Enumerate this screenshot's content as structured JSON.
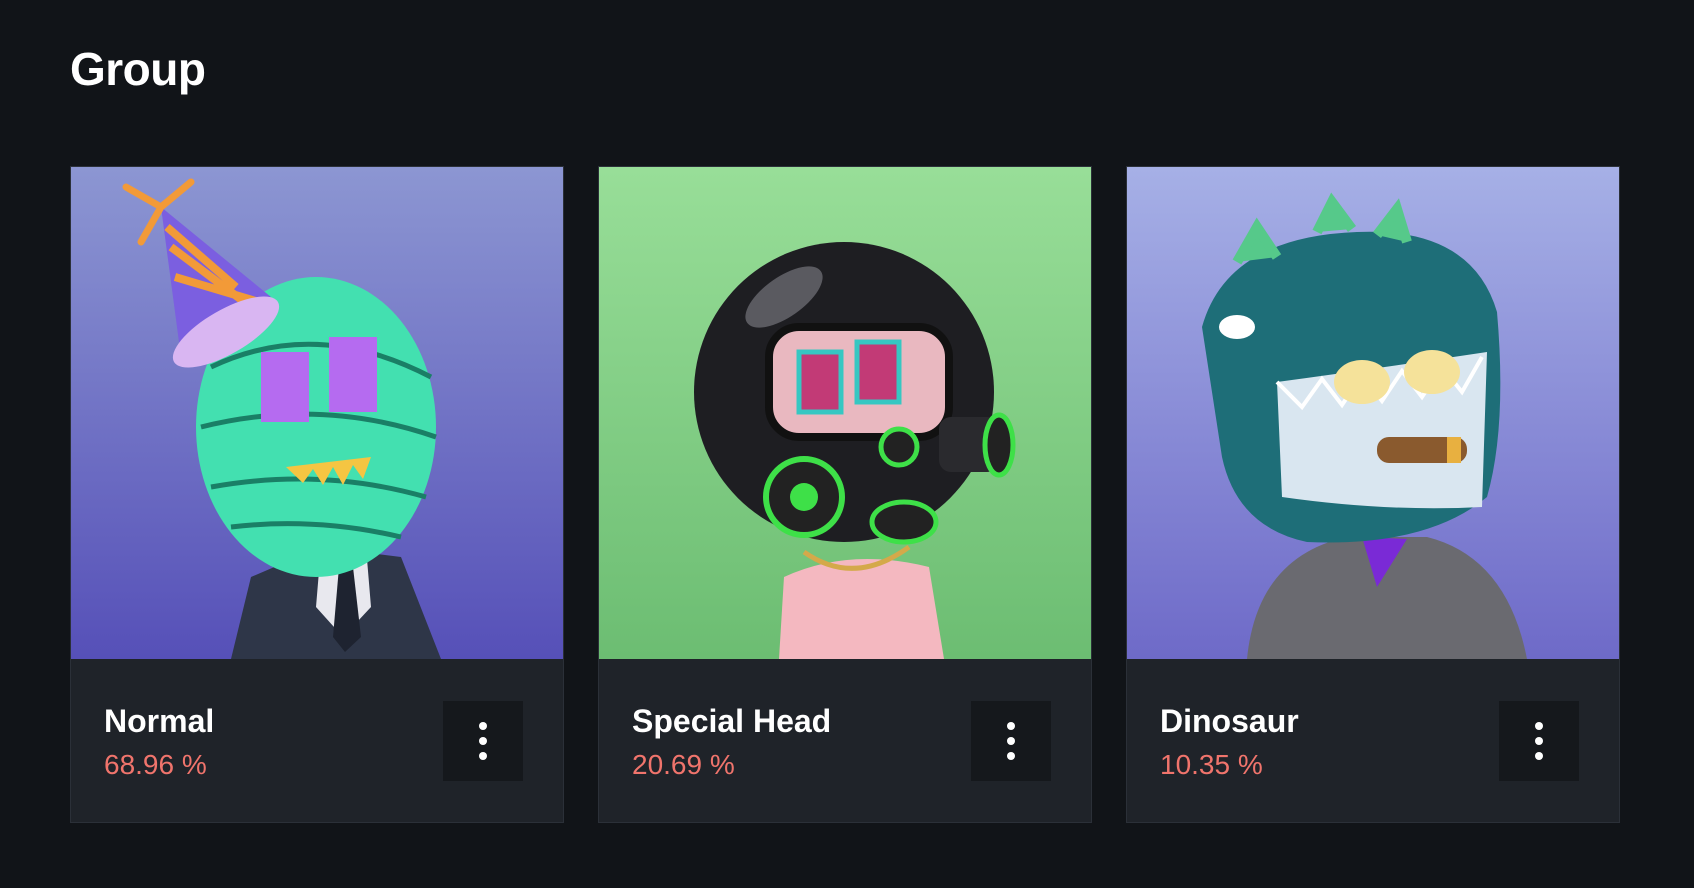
{
  "page": {
    "title": "Group"
  },
  "cards": [
    {
      "name": "Normal",
      "percent": "68.96 %",
      "image": "party-hat-scribble-character"
    },
    {
      "name": "Special Head",
      "percent": "20.69 %",
      "image": "gas-mask-helmet-character"
    },
    {
      "name": "Dinosaur",
      "percent": "10.35 %",
      "image": "dinosaur-hood-character"
    }
  ],
  "colors": {
    "background": "#111418",
    "card": "#1f2329",
    "percent": "#f0746c",
    "button": "#15181c"
  },
  "icons": {
    "more": "more-vertical-icon"
  }
}
